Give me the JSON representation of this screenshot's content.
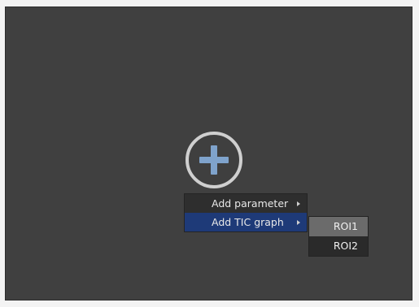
{
  "context_menu": {
    "items": [
      {
        "label": "Add parameter",
        "icon": "chevron-right-icon",
        "active": false
      },
      {
        "label": "Add TIC graph",
        "icon": "chevron-right-icon",
        "active": true
      }
    ]
  },
  "submenu": {
    "items": [
      {
        "label": "ROI1",
        "hovered": true
      },
      {
        "label": "ROI2",
        "hovered": false
      }
    ]
  },
  "add_button": {
    "icon": "plus-circle-icon"
  },
  "colors": {
    "panel_background": "#404040",
    "menu_background": "#2e2e2e",
    "menu_active": "#1e3a78",
    "plus_icon": "#7fa3cc",
    "circle_border": "#cfcfcf",
    "submenu_hover": "#6b6b6b"
  }
}
